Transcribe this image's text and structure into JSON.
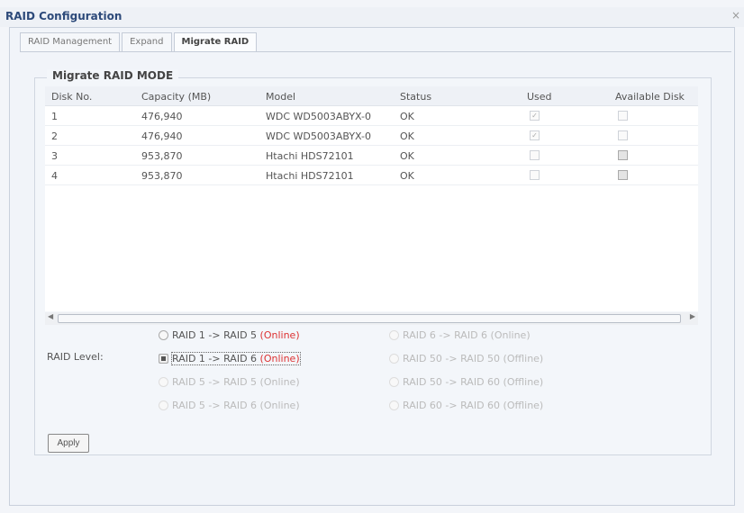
{
  "window": {
    "title": "RAID Configuration",
    "close": "×"
  },
  "tabs": [
    "RAID Management",
    "Expand",
    "Migrate RAID"
  ],
  "section": "Migrate RAID MODE",
  "columns": [
    "Disk No.",
    "Capacity (MB)",
    "Model",
    "Status",
    "Used",
    "Available Disk"
  ],
  "rows": [
    {
      "disk": "1",
      "capacity": "476,940",
      "model": "WDC WD5003ABYX-0",
      "status": "OK",
      "used": true,
      "available": false
    },
    {
      "disk": "2",
      "capacity": "476,940",
      "model": "WDC WD5003ABYX-0",
      "status": "OK",
      "used": true,
      "available": false
    },
    {
      "disk": "3",
      "capacity": "953,870",
      "model": "Htachi HDS72101",
      "status": "OK",
      "used": false,
      "available": true
    },
    {
      "disk": "4",
      "capacity": "953,870",
      "model": "Htachi HDS72101",
      "status": "OK",
      "used": false,
      "available": true
    }
  ],
  "raid_level_label": "RAID Level:",
  "options": [
    {
      "label": "RAID 1 -> RAID 5 ",
      "mode": "(Online)"
    },
    {
      "label": "RAID 1 -> RAID 6 ",
      "mode": "(Online)"
    },
    {
      "label": "RAID 5 -> RAID 5 ",
      "mode": "(Online)"
    },
    {
      "label": "RAID 5 -> RAID 6 ",
      "mode": "(Online)"
    },
    {
      "label": "RAID 6 -> RAID 6 ",
      "mode": "(Online)"
    },
    {
      "label": "RAID 50 -> RAID 50 ",
      "mode": "(Offline)"
    },
    {
      "label": "RAID 50 -> RAID 60 ",
      "mode": "(Offline)"
    },
    {
      "label": "RAID 60 -> RAID 60 ",
      "mode": "(Offline)"
    }
  ],
  "selected_option": "RAID 1 -> RAID 6",
  "apply_label": "Apply"
}
